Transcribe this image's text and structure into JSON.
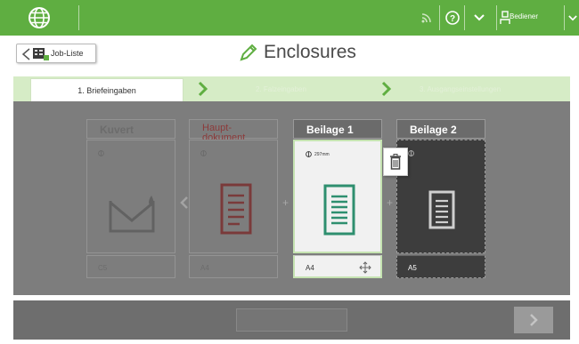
{
  "topbar": {
    "user_label": "Bediener",
    "icons": [
      "globe-icon",
      "rss-icon",
      "help-icon",
      "chevron-down-icon",
      "user-icon",
      "chevron-down-icon"
    ]
  },
  "header": {
    "back_label": "Job-Liste",
    "title": "Enclosures"
  },
  "stepper": {
    "steps": [
      "1. Briefeingaben",
      "2. Falzeingaben",
      "3. Ausgangseinstellungen"
    ]
  },
  "cards": {
    "kuvert": {
      "title": "Kuvert",
      "size": "C5",
      "measure": ""
    },
    "hauptdokument": {
      "title": "Haupt-\ndokument",
      "size": "A4",
      "measure": ""
    },
    "beilage1": {
      "title": "Beilage 1",
      "size": "A4",
      "measure": "297mm"
    },
    "beilage2": {
      "title": "Beilage 2",
      "size": "A5",
      "measure": ""
    }
  },
  "bottom": {
    "button_label": ""
  },
  "colors": {
    "brand_green": "#5fae41",
    "panel_gray": "#7d7d7d",
    "accent_teal": "#2e8f6f"
  }
}
